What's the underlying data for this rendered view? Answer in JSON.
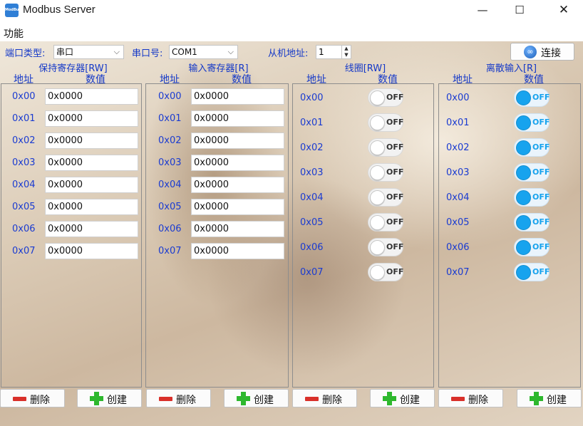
{
  "window": {
    "title": "Modbus Server",
    "icon_text": "ModBus",
    "minimize": "—",
    "maximize": "☐",
    "close": "✕"
  },
  "menu": {
    "items": [
      "功能"
    ]
  },
  "toolbar": {
    "port_type_label": "端口类型:",
    "port_type_value": "串口",
    "port_label": "串口号:",
    "port_value": "COM1",
    "slave_label": "从机地址:",
    "slave_value": "1",
    "connect_label": "连接"
  },
  "panels": [
    {
      "title": "保持寄存器[RW]",
      "addr_header": "地址",
      "value_header": "数值",
      "rows": [
        {
          "addr": "0x00",
          "value": "0x0000"
        },
        {
          "addr": "0x01",
          "value": "0x0000"
        },
        {
          "addr": "0x02",
          "value": "0x0000"
        },
        {
          "addr": "0x03",
          "value": "0x0000"
        },
        {
          "addr": "0x04",
          "value": "0x0000"
        },
        {
          "addr": "0x05",
          "value": "0x0000"
        },
        {
          "addr": "0x06",
          "value": "0x0000"
        },
        {
          "addr": "0x07",
          "value": "0x0000"
        }
      ],
      "delete_label": "删除",
      "create_label": "创建"
    },
    {
      "title": "输入寄存器[R]",
      "addr_header": "地址",
      "value_header": "数值",
      "rows": [
        {
          "addr": "0x00",
          "value": "0x0000"
        },
        {
          "addr": "0x01",
          "value": "0x0000"
        },
        {
          "addr": "0x02",
          "value": "0x0000"
        },
        {
          "addr": "0x03",
          "value": "0x0000"
        },
        {
          "addr": "0x04",
          "value": "0x0000"
        },
        {
          "addr": "0x05",
          "value": "0x0000"
        },
        {
          "addr": "0x06",
          "value": "0x0000"
        },
        {
          "addr": "0x07",
          "value": "0x0000"
        }
      ],
      "delete_label": "删除",
      "create_label": "创建"
    },
    {
      "title": "线圈[RW]",
      "addr_header": "地址",
      "value_header": "数值",
      "rows": [
        {
          "addr": "0x00",
          "value": "OFF"
        },
        {
          "addr": "0x01",
          "value": "OFF"
        },
        {
          "addr": "0x02",
          "value": "OFF"
        },
        {
          "addr": "0x03",
          "value": "OFF"
        },
        {
          "addr": "0x04",
          "value": "OFF"
        },
        {
          "addr": "0x05",
          "value": "OFF"
        },
        {
          "addr": "0x06",
          "value": "OFF"
        },
        {
          "addr": "0x07",
          "value": "OFF"
        }
      ],
      "delete_label": "删除",
      "create_label": "创建"
    },
    {
      "title": "离散输入[R]",
      "addr_header": "地址",
      "value_header": "数值",
      "rows": [
        {
          "addr": "0x00",
          "value": "OFF"
        },
        {
          "addr": "0x01",
          "value": "OFF"
        },
        {
          "addr": "0x02",
          "value": "OFF"
        },
        {
          "addr": "0x03",
          "value": "OFF"
        },
        {
          "addr": "0x04",
          "value": "OFF"
        },
        {
          "addr": "0x05",
          "value": "OFF"
        },
        {
          "addr": "0x06",
          "value": "OFF"
        },
        {
          "addr": "0x07",
          "value": "OFF"
        }
      ],
      "delete_label": "删除",
      "create_label": "创建"
    }
  ],
  "colors": {
    "label_blue": "#1438c8",
    "toggle_blue": "#17a3ee",
    "delete_red": "#d9302a",
    "create_green": "#2eb82e"
  }
}
